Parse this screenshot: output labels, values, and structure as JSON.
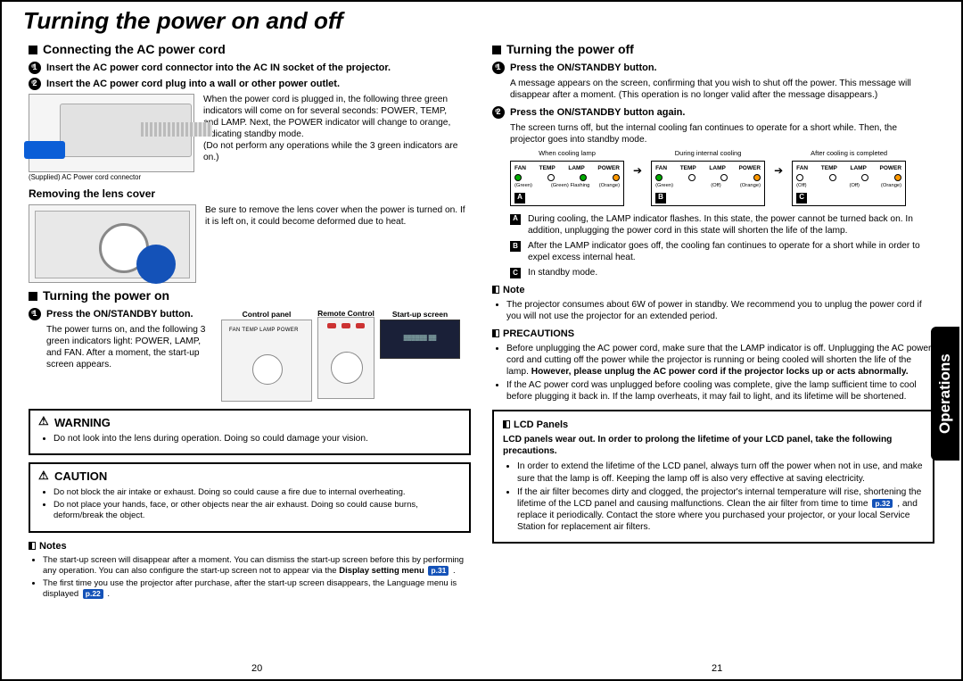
{
  "side_tab": "Operations",
  "title": "Turning the power on and off",
  "left": {
    "sec1_h": "Connecting the AC power cord",
    "step1": "Insert the AC power cord connector into the AC IN socket of the projector.",
    "step2": "Insert the AC power cord plug into a wall or other power outlet.",
    "fig1_caption": "(Supplied) AC Power cord connector",
    "plug_text": "When the power cord is plugged in, the following three green indicators will come on for several seconds: POWER, TEMP, and LAMP. Next, the POWER indicator will change to orange, indicating standby mode.",
    "plug_note": "(Do not perform any operations while the 3 green indicators are on.)",
    "sec2_h": "Removing the lens cover",
    "lens_text": "Be sure to remove the lens cover when the power is turned on. If it is left on, it could become deformed due to heat.",
    "sec3_h": "Turning the power on",
    "on_step_h": "Press the ON/STANDBY button.",
    "on_step_body": "The power turns on, and the following 3 green indicators light: POWER, LAMP, and FAN. After a moment, the start-up screen appears.",
    "lbl_control_panel": "Control panel",
    "lbl_remote": "Remote Control",
    "lbl_startup": "Start-up screen",
    "led_row_text": "FAN  TEMP  LAMP  POWER",
    "warning_h": "WARNING",
    "warning_b1": "Do not look into the lens during operation. Doing so could damage your vision.",
    "caution_h": "CAUTION",
    "caution_b1": "Do not block the air intake or exhaust. Doing so could cause a fire due to internal overheating.",
    "caution_b2": "Do not place your hands, face, or other objects near the air exhaust. Doing so could cause burns, deform/break the object.",
    "notes_h": "Notes",
    "note1a": "The start-up screen will disappear after a moment. You can dismiss the start-up screen before this by performing any operation. You can also configure the start-up screen not to appear via the ",
    "note1b": "Display setting menu",
    "note1_pref": "p.31",
    "note2a": "The first time you use the projector after purchase, after the start-up screen disappears, the Language menu is displayed",
    "note2_pref": "p.22"
  },
  "right": {
    "sec_h": "Turning the power off",
    "step1_h": "Press the ON/STANDBY button.",
    "step1_body": "A message appears on the screen, confirming that you wish to shut off the power. This message will disappear after a moment. (This operation is no longer valid after the message disappears.)",
    "step2_h": "Press the ON/STANDBY button again.",
    "step2_body": "The screen turns off, but the internal cooling fan continues to operate for a short while. Then, the projector goes into standby mode.",
    "led_title_a": "When cooling lamp",
    "led_title_b": "During internal cooling",
    "led_title_c": "After cooling is completed",
    "led_h1": "FAN",
    "led_h2": "TEMP",
    "led_h3": "LAMP",
    "led_h4": "POWER",
    "led_a_s1": "(Green)",
    "led_a_s3": "(Green) Flashing",
    "led_a_s4": "(Orange)",
    "led_b_s1": "(Green)",
    "led_b_s3": "(Off)",
    "led_b_s4": "(Orange)",
    "led_c_s1": "(Off)",
    "led_c_s3": "(Off)",
    "led_c_s4": "(Orange)",
    "abc_a": "During cooling, the LAMP indicator flashes. In this state, the power cannot be turned back on. In addition, unplugging the power cord in this state will shorten the life of the lamp.",
    "abc_b": "After the LAMP indicator goes off, the cooling fan continues to operate for a short while in order to expel excess internal heat.",
    "abc_c": "In standby mode.",
    "note_h": "Note",
    "note_body": "The projector consumes about 6W of power in standby. We recommend you to unplug the power cord if you will not use the projector for an extended period.",
    "prec_h": "PRECAUTIONS",
    "prec_b1a": "Before unplugging the AC power cord, make sure that the LAMP indicator is off. Unplugging the AC power cord and cutting off the power while the projector is running or being cooled will shorten the life of the lamp. ",
    "prec_b1b": "However, please unplug the AC power cord if the projector locks up or acts abnormally.",
    "prec_b2": "If the AC power cord was unplugged before cooling was complete, give the lamp sufficient time to cool before plugging it back in. If the lamp overheats, it may fail to light, and its lifetime will be shortened.",
    "lcd_h": "LCD Panels",
    "lcd_lead": "LCD panels wear out. In order to prolong the lifetime of your LCD panel, take the following precautions.",
    "lcd_b1": "In order to extend the lifetime of the LCD panel, always turn off the power when not in use, and make sure that the lamp is off. Keeping the lamp off is also very effective at saving electricity.",
    "lcd_b2a": "If the air filter becomes dirty and clogged, the projector's internal temperature will rise, shortening the lifetime of the LCD panel and causing malfunctions. Clean the air filter from time to time ",
    "lcd_b2_pref": "p.32",
    "lcd_b2b": " , and replace it periodically. Contact the store where you purchased your projector, or your local Service Station for replacement air filters."
  },
  "page_left": "20",
  "page_right": "21"
}
